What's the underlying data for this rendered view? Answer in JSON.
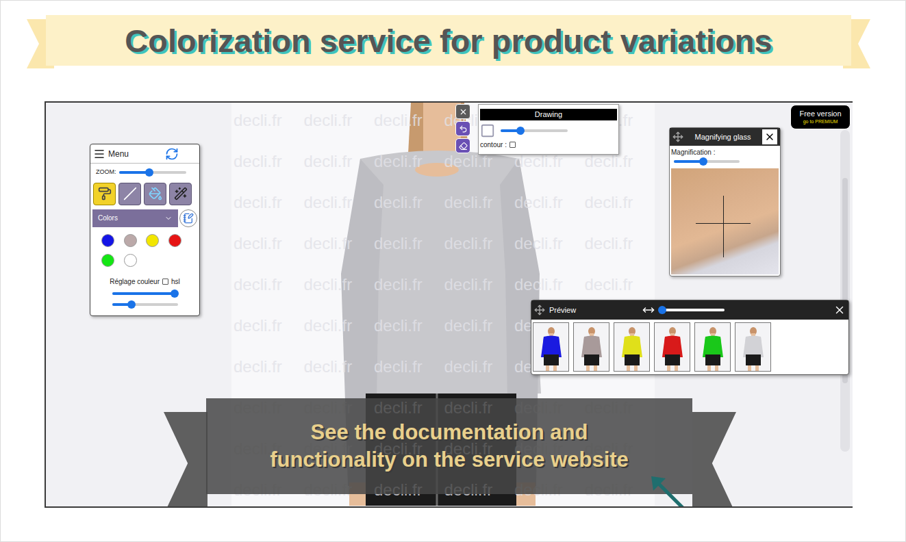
{
  "banner": {
    "title": "Colorization service for product variations"
  },
  "app": {
    "watermark": "decli.fr",
    "menu": {
      "title": "Menu",
      "zoom_label": "ZOOM:",
      "zoom_level": 0.45,
      "tools": [
        {
          "kind": "roller",
          "selected": true
        },
        {
          "kind": "line",
          "selected": false
        },
        {
          "kind": "bucket",
          "selected": false
        },
        {
          "kind": "wand",
          "selected": false
        }
      ],
      "select": "Colors",
      "colors": [
        {
          "color": "#1414e6"
        },
        {
          "color": "#bba9a9"
        },
        {
          "color": "#f2e600"
        },
        {
          "color": "#e61414"
        },
        {
          "color": "#14e614"
        },
        {
          "color": "#ffffff"
        }
      ],
      "adjust_label": "Réglage couleur",
      "hsl_label": "hsl",
      "hsl_checked": false,
      "sliders": [
        {
          "level": 0.95
        },
        {
          "level": 0.3
        }
      ]
    },
    "drawing": {
      "title": "Drawing",
      "size_level": 0.3,
      "contour_label": "contour :",
      "contour_checked": false
    },
    "magnifier": {
      "title": "Magnifying glass",
      "label": "Magnification :",
      "level": 0.45
    },
    "badge": {
      "title": "Free version",
      "link": "go to PREMIUM"
    },
    "preview": {
      "title": "Préview",
      "level": 0.05,
      "thumbnails": [
        {
          "color": "#1a1ae0"
        },
        {
          "color": "#a89a9a"
        },
        {
          "color": "#e0e01a"
        },
        {
          "color": "#d81a1a"
        },
        {
          "color": "#1ac81a"
        },
        {
          "color": "#d2d2d6"
        }
      ]
    }
  },
  "footer_banner": {
    "lines": [
      "See the documentation and",
      "functionality on the service website"
    ]
  }
}
